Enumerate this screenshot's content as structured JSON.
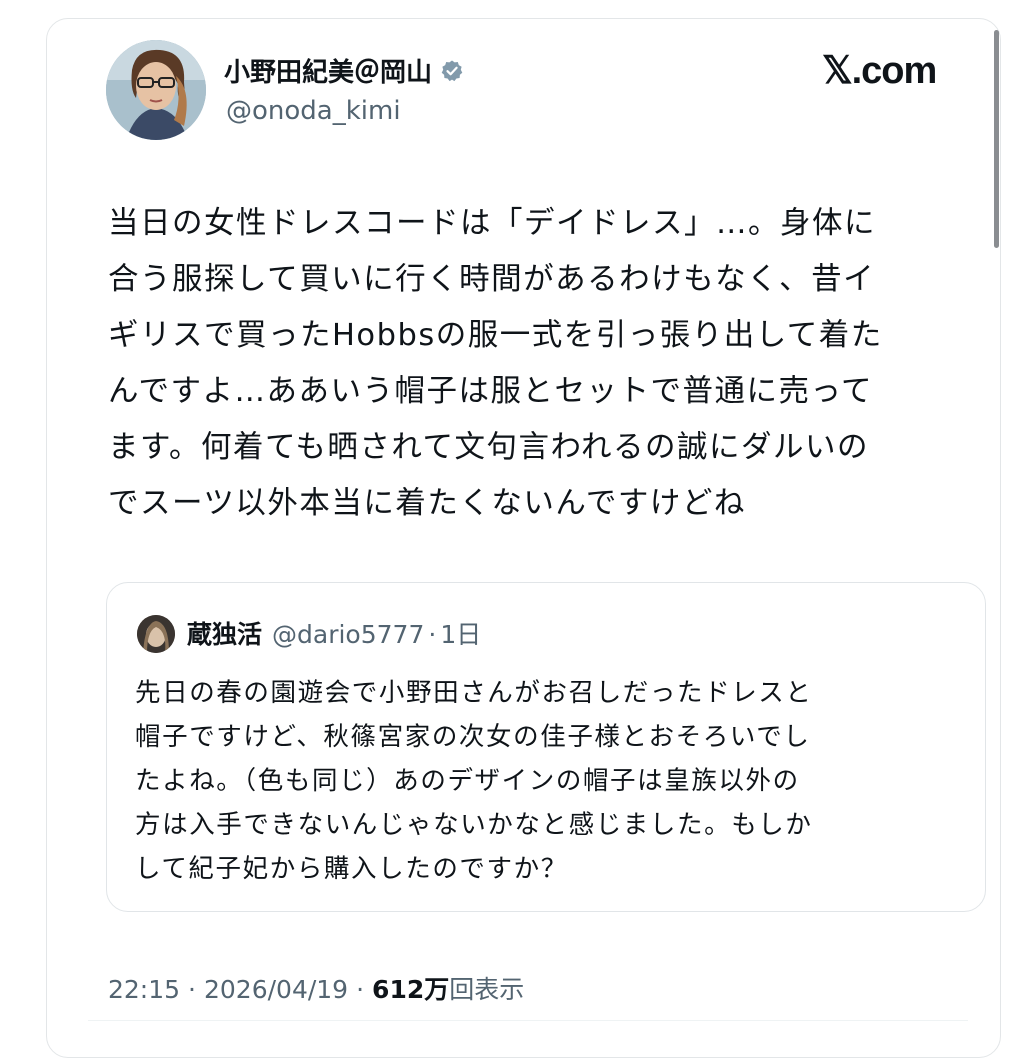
{
  "brand": "𝕏.com",
  "author": {
    "display_name": "小野田紀美＠岡山",
    "handle": "@onoda_kimi",
    "verified_icon": "verified-badge-icon",
    "badge_color": "#829aab"
  },
  "tweet": {
    "text": "当日の女性ドレスコードは「デイドレス」…。身体に\n合う服探して買いに行く時間があるわけもなく、昔イ\nギリスで買ったHobbsの服一式を引っ張り出して着た\nんですよ…ああいう帽子は服とセットで普通に売って\nます。何着ても晒されて文句言われるの誠にダルいの\nでスーツ以外本当に着たくないんですけどね"
  },
  "quoted": {
    "display_name": "蔵独活",
    "handle": "@dario5777",
    "separator": "·",
    "time": "1日",
    "text": "先日の春の園遊会で小野田さんがお召しだったドレスと\n帽子ですけど、秋篠宮家の次女の佳子様とおそろいでし\nたよね。（色も同じ）あのデザインの帽子は皇族以外の\n方は入手できないんじゃないかなと感じました。もしか\nして紀子妃から購入したのですか？"
  },
  "meta": {
    "time": "22:15",
    "dot": "·",
    "date": "2026/04/19",
    "dot2": "·",
    "views_count": "612万",
    "views_label": "回表示"
  },
  "colors": {
    "text_primary": "#0f1419",
    "text_secondary": "#536471",
    "border": "#e1e5e8"
  }
}
